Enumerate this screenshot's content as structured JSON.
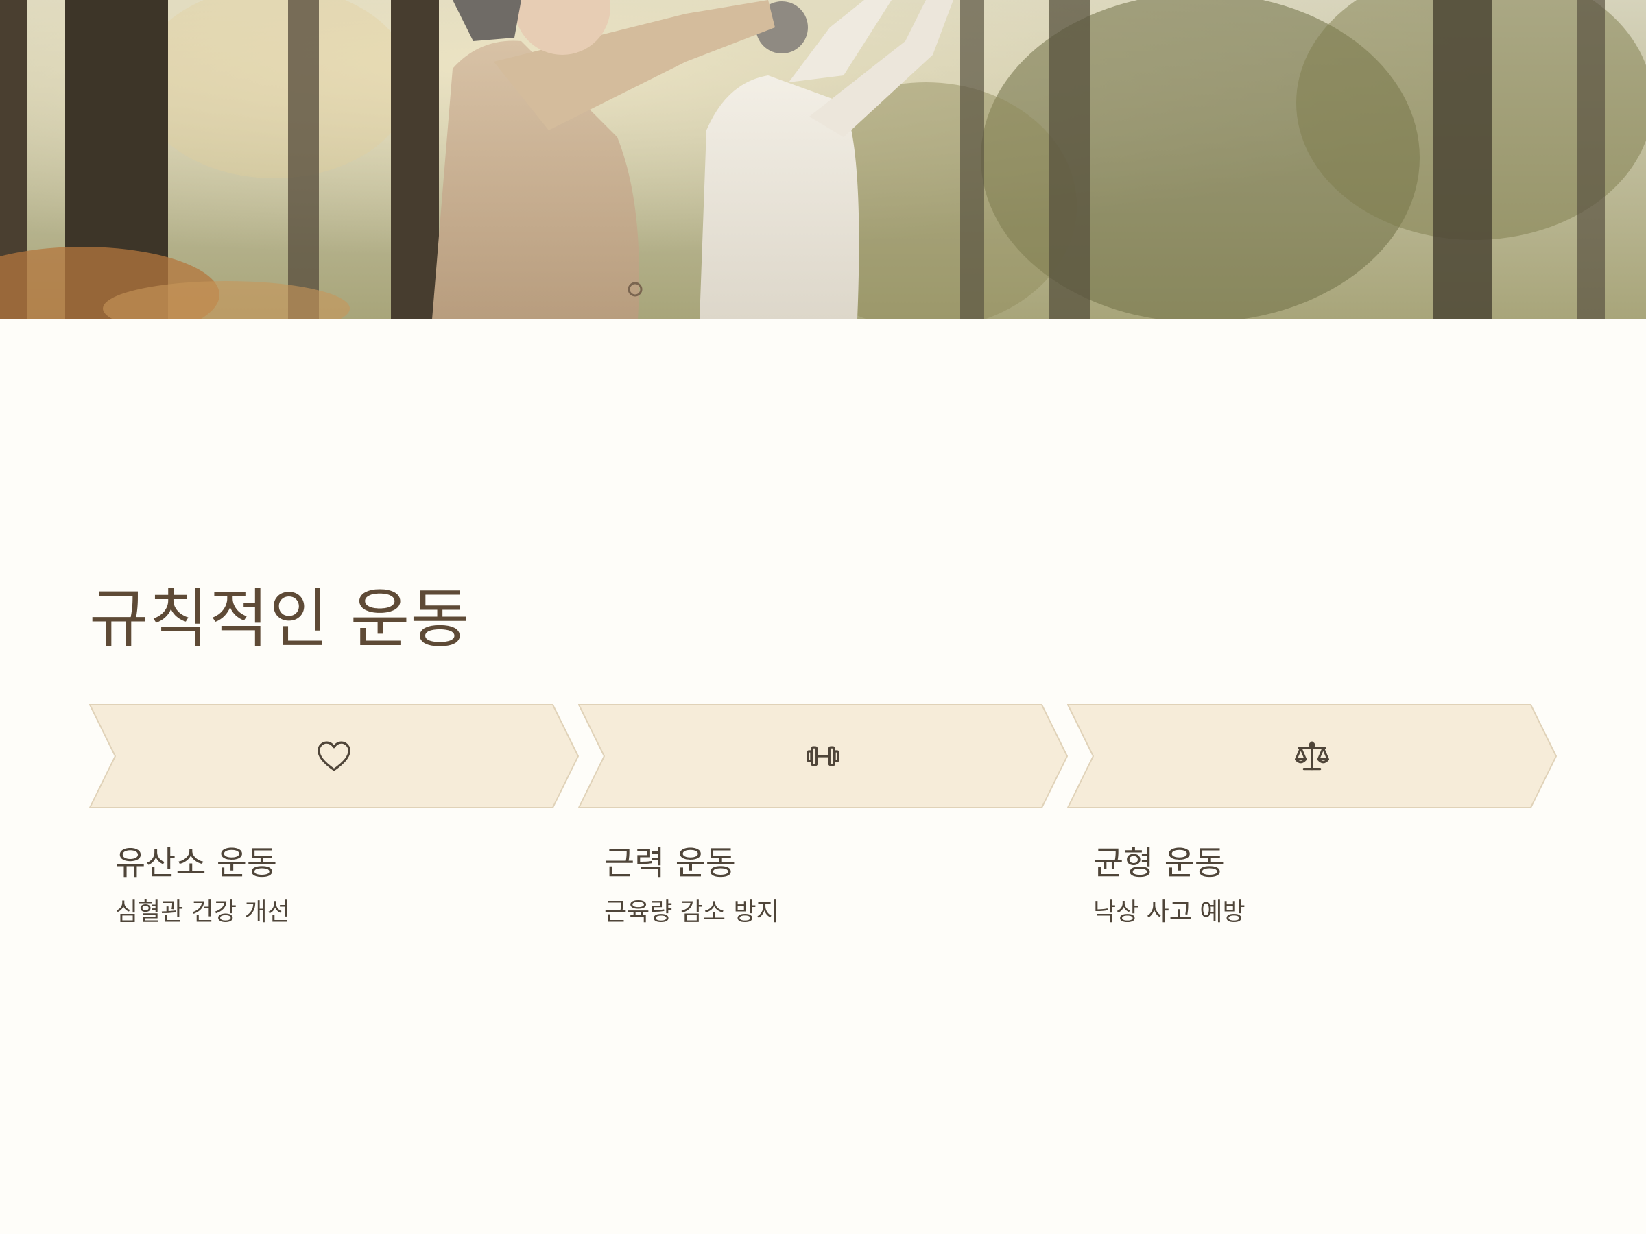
{
  "heading": "규칙적인 운동",
  "colors": {
    "background": "#fefdf9",
    "chevron_fill": "#f6ecd9",
    "chevron_border": "#e0d2b8",
    "heading_text": "#5e4a36",
    "body_text": "#4f4539"
  },
  "steps": [
    {
      "icon": "heart-icon",
      "title": "유산소 운동",
      "description": "심혈관 건강 개선"
    },
    {
      "icon": "dumbbell-icon",
      "title": "근력 운동",
      "description": "근육량 감소 방지"
    },
    {
      "icon": "balance-scale-icon",
      "title": "균형 운동",
      "description": "낙상 사고 예방"
    }
  ]
}
